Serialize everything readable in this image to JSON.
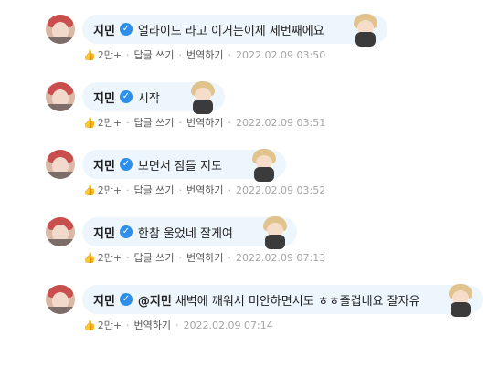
{
  "comments": [
    {
      "name": "지민",
      "mention": "",
      "text": "얼라이드 라고 이거는이제 세번째에요",
      "likes": "2만+",
      "reply": "답글 쓰기",
      "translate": "번역하기",
      "date": "2022.02.09 03:50"
    },
    {
      "name": "지민",
      "mention": "",
      "text": "시작",
      "likes": "2만+",
      "reply": "답글 쓰기",
      "translate": "번역하기",
      "date": "2022.02.09 03:51"
    },
    {
      "name": "지민",
      "mention": "",
      "text": "보면서 잠들 지도",
      "likes": "2만+",
      "reply": "답글 쓰기",
      "translate": "번역하기",
      "date": "2022.02.09 03:52"
    },
    {
      "name": "지민",
      "mention": "",
      "text": "한참 울었네 잘게여",
      "likes": "2만+",
      "reply": "답글 쓰기",
      "translate": "번역하기",
      "date": "2022.02.09 07:13"
    },
    {
      "name": "지민",
      "mention": "@지민",
      "text": "새벽에 깨워서 미안하면서도 ㅎㅎ즐겁네요 잘자유",
      "likes": "2만+",
      "reply": "",
      "translate": "번역하기",
      "date": "2022.02.09 07:14"
    }
  ],
  "icons": {
    "verified": "verified-check-icon",
    "like": "thumbs-up-icon"
  },
  "colors": {
    "bubble": "#eef6fd",
    "verified": "#2e8fea"
  }
}
